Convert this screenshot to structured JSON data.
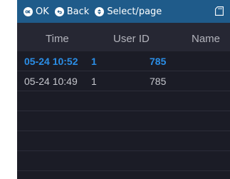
{
  "topbar": {
    "hints": [
      {
        "icon": "ok-icon",
        "label": "OK"
      },
      {
        "icon": "back-icon",
        "label": "Back"
      },
      {
        "icon": "up-down-icon",
        "label": "Select/page"
      }
    ],
    "status_icon": "sd-card-icon"
  },
  "table": {
    "columns": [
      "Time",
      "User ID",
      "Name"
    ],
    "rows": [
      {
        "time": "05-24 10:52",
        "user_id": "1",
        "name": "785",
        "selected": true
      },
      {
        "time": "05-24 10:49",
        "user_id": "1",
        "name": "785",
        "selected": false
      },
      {
        "time": "",
        "user_id": "",
        "name": "",
        "selected": false
      },
      {
        "time": "",
        "user_id": "",
        "name": "",
        "selected": false
      },
      {
        "time": "",
        "user_id": "",
        "name": "",
        "selected": false
      },
      {
        "time": "",
        "user_id": "",
        "name": "",
        "selected": false
      }
    ]
  },
  "colors": {
    "topbar": "#1f5b8a",
    "background": "#1b1c26",
    "selected_text": "#2b8ee6",
    "normal_text": "#c6c7cd"
  }
}
